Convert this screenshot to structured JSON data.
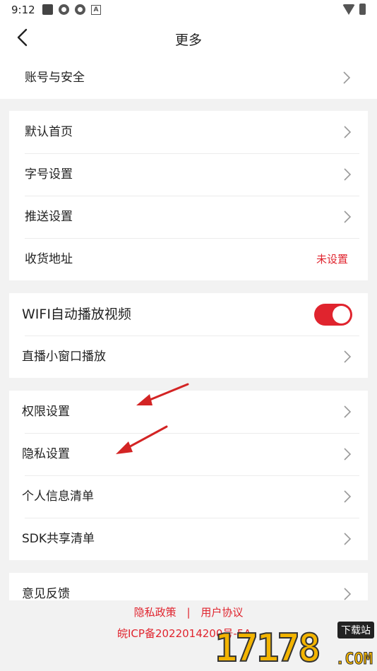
{
  "status": {
    "time": "9:12"
  },
  "header": {
    "title": "更多"
  },
  "groups": {
    "g0": {
      "account": "账号与安全"
    },
    "g1": {
      "default_home": "默认首页",
      "font_size": "字号设置",
      "push": "推送设置",
      "address": "收货地址",
      "address_value": "未设置"
    },
    "g2": {
      "wifi_autoplay": "WIFI自动播放视频",
      "wifi_autoplay_on": true,
      "live_mini": "直播小窗口播放"
    },
    "g3": {
      "permissions": "权限设置",
      "privacy": "隐私设置",
      "personal_info": "个人信息清单",
      "sdk_list": "SDK共享清单"
    },
    "g4": {
      "feedback": "意见反馈"
    }
  },
  "footer": {
    "privacy_policy": "隐私政策",
    "separator": "|",
    "user_agreement": "用户协议",
    "icp": "皖ICP备2022014200号-5A"
  },
  "watermark": {
    "number": "17178",
    "tag": "下载站",
    "domain": ".COM"
  },
  "colors": {
    "accent": "#e0242e",
    "background": "#f2f2f2"
  }
}
